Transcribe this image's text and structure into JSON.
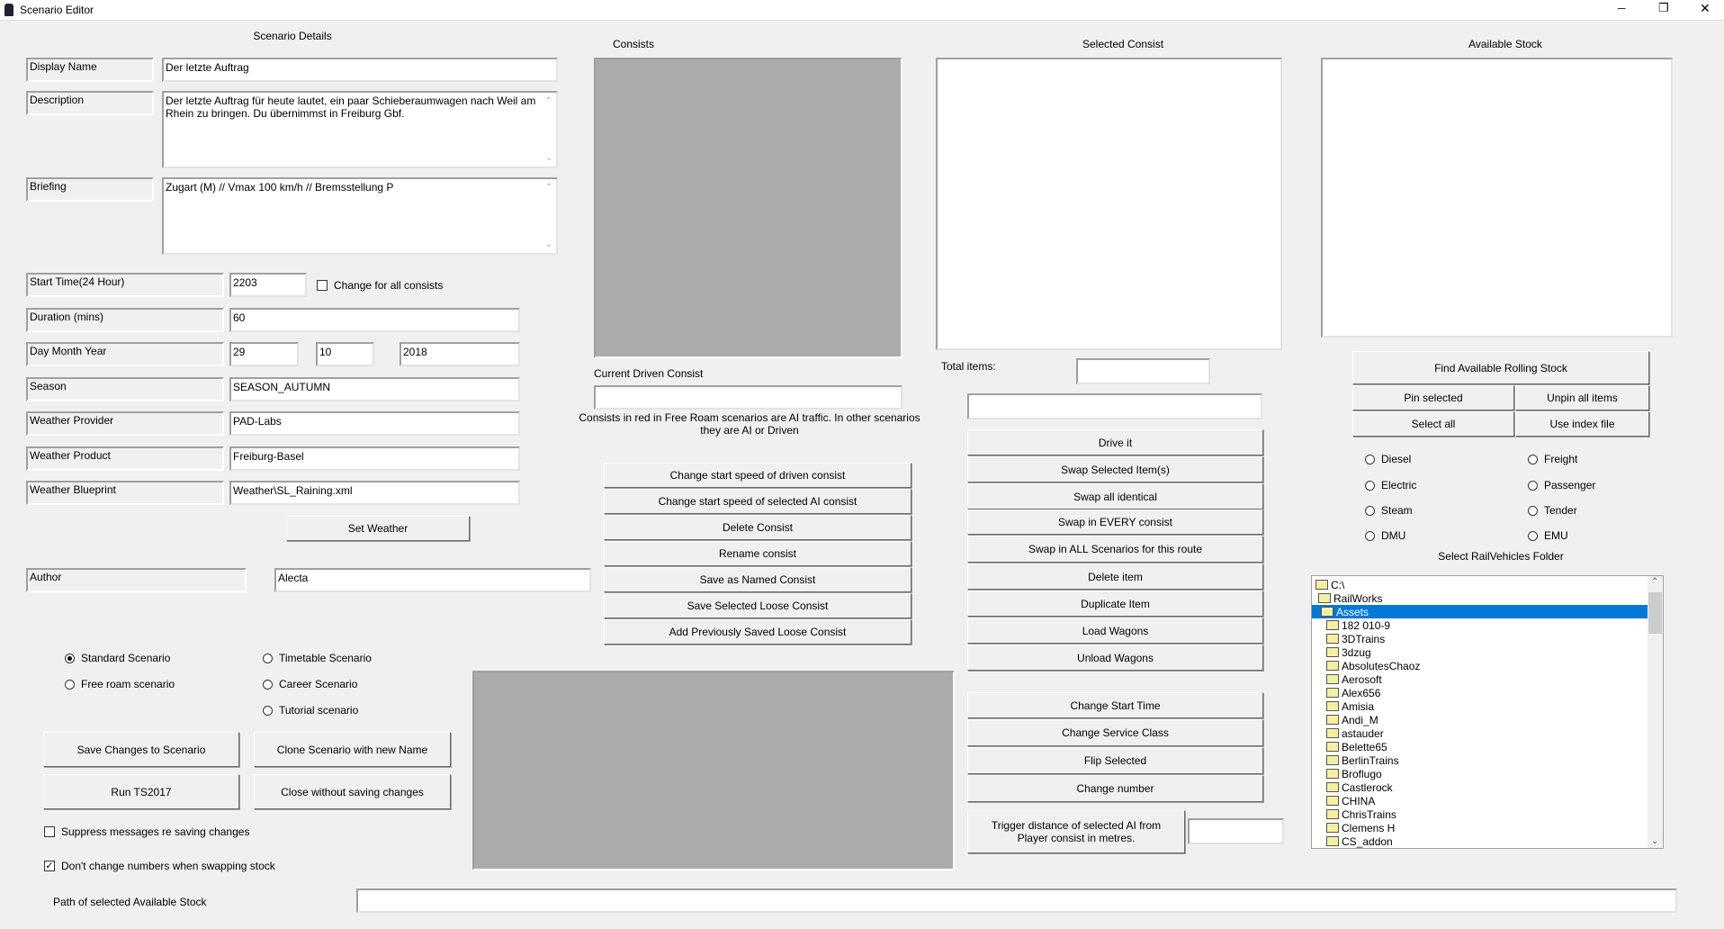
{
  "window": {
    "title": "Scenario Editor",
    "minimize": "─",
    "restore": "❐",
    "close": "✕"
  },
  "details": {
    "heading": "Scenario Details",
    "display_name_label": "Display Name",
    "display_name": "Der letzte Auftrag",
    "description_label": "Description",
    "description": "Der letzte Auftrag für heute lautet, ein paar Schieberaumwagen nach Weil am Rhein zu bringen. Du übernimmst in Freiburg Gbf.",
    "briefing_label": "Briefing",
    "briefing": "Zugart (M) // Vmax 100 km/h // Bremsstellung P",
    "start_time_label": "Start Time(24 Hour)",
    "start_time": "2203",
    "change_all_label": "Change for all consists",
    "duration_label": "Duration (mins)",
    "duration": "60",
    "date_label": "Day Month Year",
    "day": "29",
    "month": "10",
    "year": "2018",
    "season_label": "Season",
    "season": "SEASON_AUTUMN",
    "weather_provider_label": "Weather Provider",
    "weather_provider": "PAD-Labs",
    "weather_product_label": "Weather Product",
    "weather_product": "Freiburg-Basel",
    "weather_blueprint_label": "Weather Blueprint",
    "weather_blueprint": "Weather\\SL_Raining.xml",
    "set_weather": "Set Weather",
    "author_label": "Author",
    "author": "Alecta"
  },
  "scenario_types": [
    {
      "label": "Standard Scenario",
      "checked": true
    },
    {
      "label": "Free roam scenario",
      "checked": false
    },
    {
      "label": "Timetable Scenario",
      "checked": false
    },
    {
      "label": "Career Scenario",
      "checked": false
    },
    {
      "label": "Tutorial scenario",
      "checked": false
    }
  ],
  "actions": {
    "save": "Save Changes to Scenario",
    "clone": "Clone Scenario with new Name",
    "run": "Run TS2017",
    "close": "Close without saving changes"
  },
  "options": {
    "suppress": "Suppress messages re saving changes",
    "suppress_checked": false,
    "dont_change": "Don't change numbers when swapping stock",
    "dont_change_checked": true
  },
  "path": {
    "label": "Path of selected Available Stock",
    "value": ""
  },
  "consists": {
    "heading": "Consists",
    "current_label": "Current Driven Consist",
    "current": "",
    "note": "Consists in red in Free Roam scenarios are AI traffic. In other scenarios they are AI or Driven",
    "buttons": [
      "Change start speed of driven consist",
      "Change start speed of selected AI consist",
      "Delete Consist",
      "Rename consist",
      "Save as Named Consist",
      "Save Selected Loose Consist",
      "Add Previously Saved Loose Consist"
    ]
  },
  "selected": {
    "heading": "Selected Consist",
    "total_label": "Total items:",
    "total": "",
    "field": "",
    "buttons": [
      "Drive it",
      "Swap Selected Item(s)",
      "Swap all identical",
      "Swap in EVERY consist",
      "Swap in ALL Scenarios for this route",
      "Delete item",
      "Duplicate Item",
      "Load Wagons",
      "Unload Wagons"
    ],
    "buttons2": [
      "Change Start Time",
      "Change Service Class",
      "Flip Selected",
      "Change number"
    ],
    "trigger_label": "Trigger distance of selected AI from Player consist in metres.",
    "trigger": ""
  },
  "available": {
    "heading": "Available Stock",
    "find": "Find Available Rolling Stock",
    "pin": "Pin selected",
    "unpin": "Unpin all items",
    "select_all": "Select all",
    "use_index": "Use index file",
    "filters": [
      {
        "label": "Diesel"
      },
      {
        "label": "Electric"
      },
      {
        "label": "Steam"
      },
      {
        "label": "DMU"
      },
      {
        "label": "Freight"
      },
      {
        "label": "Passenger"
      },
      {
        "label": "Tender"
      },
      {
        "label": "EMU"
      }
    ],
    "folder_label": "Select RailVehicles Folder",
    "tree": [
      {
        "label": "C:\\",
        "level": 0,
        "open": true
      },
      {
        "label": "RailWorks",
        "level": 1,
        "open": true
      },
      {
        "label": "Assets",
        "level": 2,
        "open": true,
        "selected": true
      },
      {
        "label": "182 010-9",
        "level": 3
      },
      {
        "label": "3DTrains",
        "level": 3
      },
      {
        "label": "3dzug",
        "level": 3
      },
      {
        "label": "AbsolutesChaoz",
        "level": 3
      },
      {
        "label": "Aerosoft",
        "level": 3
      },
      {
        "label": "Alex656",
        "level": 3
      },
      {
        "label": "Amisia",
        "level": 3
      },
      {
        "label": "Andi_M",
        "level": 3
      },
      {
        "label": "astauder",
        "level": 3
      },
      {
        "label": "Belette65",
        "level": 3
      },
      {
        "label": "BerlinTrains",
        "level": 3
      },
      {
        "label": "Broflugo",
        "level": 3
      },
      {
        "label": "Castlerock",
        "level": 3
      },
      {
        "label": "CHINA",
        "level": 3
      },
      {
        "label": "ChrisTrains",
        "level": 3
      },
      {
        "label": "Clemens H",
        "level": 3
      },
      {
        "label": "CS_addon",
        "level": 3
      }
    ]
  }
}
